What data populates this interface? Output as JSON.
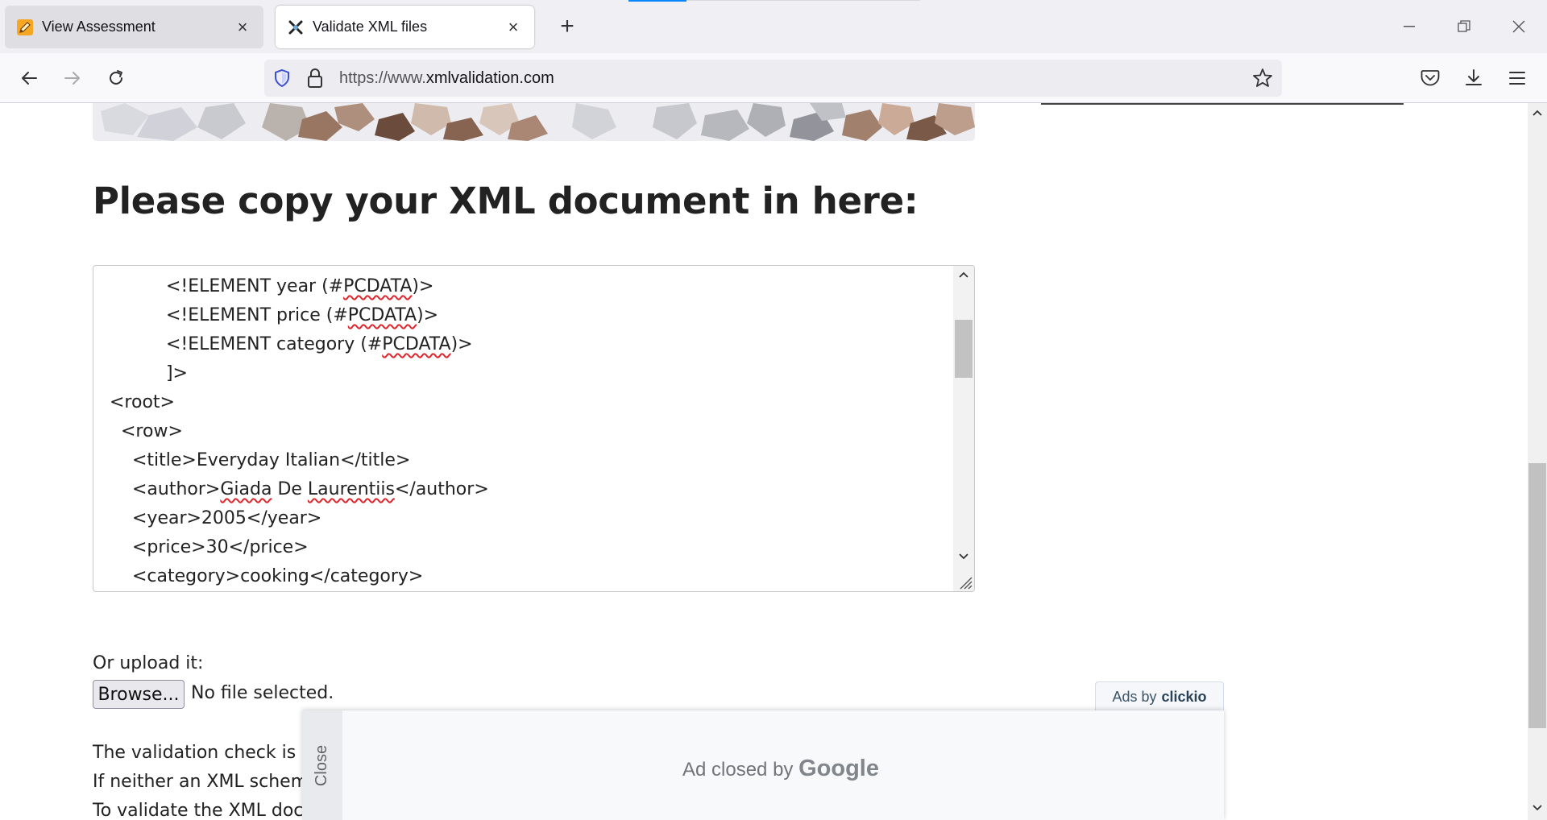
{
  "browser": {
    "tabs": [
      {
        "title": "View Assessment",
        "favicon": "pencil-icon"
      },
      {
        "title": "Validate XML files",
        "favicon": "xml-validation-icon"
      }
    ],
    "url_prefix": "https://www.",
    "url_domain": "xmlvalidation.com"
  },
  "page": {
    "heading": "Please copy your XML document in here:",
    "xml_lines": [
      {
        "indent": "          ",
        "parts": [
          {
            "t": "<!ELEMENT year (#"
          },
          {
            "t": "PCDATA",
            "spell": true
          },
          {
            "t": ")>"
          }
        ]
      },
      {
        "indent": "          ",
        "parts": [
          {
            "t": "<!ELEMENT price (#"
          },
          {
            "t": "PCDATA",
            "spell": true
          },
          {
            "t": ")>"
          }
        ]
      },
      {
        "indent": "          ",
        "parts": [
          {
            "t": "<!ELEMENT category (#"
          },
          {
            "t": "PCDATA",
            "spell": true
          },
          {
            "t": ")>"
          }
        ]
      },
      {
        "indent": "          ",
        "parts": [
          {
            "t": "]>"
          }
        ]
      },
      {
        "indent": "",
        "parts": [
          {
            "t": "<root>"
          }
        ]
      },
      {
        "indent": "  ",
        "parts": [
          {
            "t": "<row>"
          }
        ]
      },
      {
        "indent": "    ",
        "parts": [
          {
            "t": "<title>Everyday Italian</title>"
          }
        ]
      },
      {
        "indent": "    ",
        "parts": [
          {
            "t": "<author>"
          },
          {
            "t": "Giada",
            "spell": true
          },
          {
            "t": " De "
          },
          {
            "t": "Laurentiis",
            "spell": true
          },
          {
            "t": "</author>"
          }
        ]
      },
      {
        "indent": "    ",
        "parts": [
          {
            "t": "<year>2005</year>"
          }
        ]
      },
      {
        "indent": "    ",
        "parts": [
          {
            "t": "<price>30</price>"
          }
        ]
      },
      {
        "indent": "    ",
        "parts": [
          {
            "t": "<category>cooking</category>"
          }
        ]
      }
    ],
    "upload_label": "Or upload it:",
    "browse_label": "Browse...",
    "no_file_text": "No file selected.",
    "paragraphs": [
      "The validation check is pe",
      "If neither an XML schema",
      "To validate the XML docu"
    ]
  },
  "ad": {
    "close_label": "Close",
    "closed_by_text": "Ad closed by",
    "google_word": "Google",
    "ads_by_prefix": "Ads by",
    "ads_by_brand": "clickio"
  },
  "colors": {
    "accent": "#0a84ff",
    "spell_error": "#e0262d"
  }
}
